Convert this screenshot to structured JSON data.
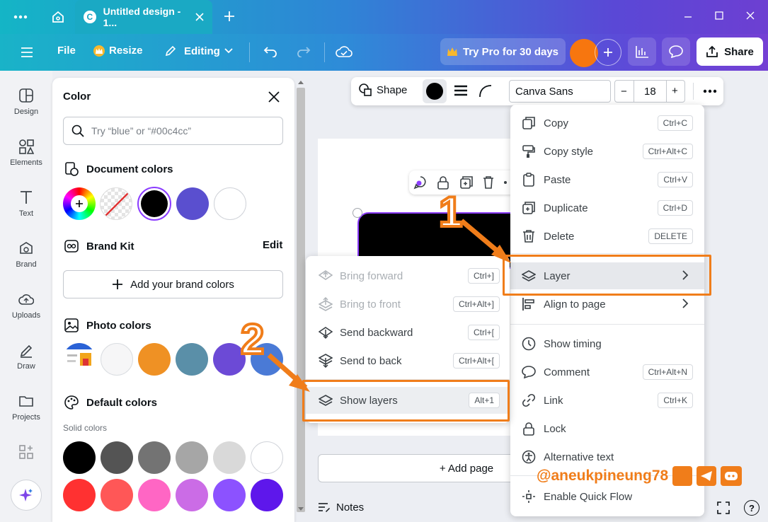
{
  "titlebar": {
    "tab_title": "Untitled design - 1...",
    "tab_logo": "C"
  },
  "toolbar": {
    "file": "File",
    "resize": "Resize",
    "editing": "Editing",
    "try_pro": "Try Pro for 30 days",
    "share": "Share",
    "avatar_color": "#f7760f"
  },
  "rail": [
    {
      "label": "Design",
      "icon": "design-icon"
    },
    {
      "label": "Elements",
      "icon": "elements-icon"
    },
    {
      "label": "Text",
      "icon": "text-icon"
    },
    {
      "label": "Brand",
      "icon": "brand-icon"
    },
    {
      "label": "Uploads",
      "icon": "uploads-icon"
    },
    {
      "label": "Draw",
      "icon": "draw-icon"
    },
    {
      "label": "Projects",
      "icon": "projects-icon"
    }
  ],
  "color_panel": {
    "title": "Color",
    "search_placeholder": "Try “blue” or “#00c4cc”",
    "document_colors_title": "Document colors",
    "document_colors": [
      "#000000",
      "#5a4fcf",
      "#ffffff"
    ],
    "brand_kit_title": "Brand Kit",
    "brand_kit_edit": "Edit",
    "add_brand_colors": "Add your brand colors",
    "photo_colors_title": "Photo colors",
    "photo_colors": [
      "#f6f6f7",
      "#ef9124",
      "#5a8fa8",
      "#6c4ad6",
      "#4a7ad6"
    ],
    "default_colors_title": "Default colors",
    "solid_colors_label": "Solid colors",
    "default_row1": [
      "#000000",
      "#545454",
      "#737373",
      "#a6a6a6",
      "#d9d9d9",
      "#ffffff"
    ],
    "default_row2": [
      "#ff3131",
      "#ff5757",
      "#ff66c4",
      "#cb6ce6",
      "#8c52ff",
      "#5e17eb"
    ]
  },
  "element_toolbar": {
    "shape": "Shape",
    "font": "Canva Sans",
    "font_size": "18",
    "minus": "−",
    "plus": "+"
  },
  "canvas": {
    "add_page": "+ Add page",
    "notes": "Notes"
  },
  "context_menu": [
    {
      "label": "Copy",
      "shortcut": "Ctrl+C",
      "icon": "copy-icon"
    },
    {
      "label": "Copy style",
      "shortcut": "Ctrl+Alt+C",
      "icon": "copy-style-icon"
    },
    {
      "label": "Paste",
      "shortcut": "Ctrl+V",
      "icon": "paste-icon"
    },
    {
      "label": "Duplicate",
      "shortcut": "Ctrl+D",
      "icon": "duplicate-icon"
    },
    {
      "label": "Delete",
      "shortcut": "DELETE",
      "icon": "trash-icon"
    },
    {
      "label": "Layer",
      "icon": "layers-icon"
    },
    {
      "label": "Align to page",
      "icon": "align-icon"
    },
    {
      "label": "Show timing",
      "icon": "clock-icon"
    },
    {
      "label": "Comment",
      "shortcut": "Ctrl+Alt+N",
      "icon": "comment-icon"
    },
    {
      "label": "Link",
      "shortcut": "Ctrl+K",
      "icon": "link-icon"
    },
    {
      "label": "Lock",
      "icon": "lock-icon"
    },
    {
      "label": "Alternative text",
      "icon": "accessibility-icon"
    },
    {
      "label": "Enable Quick Flow",
      "icon": "quick-flow-icon"
    }
  ],
  "layer_submenu": [
    {
      "label": "Bring forward",
      "shortcut": "Ctrl+]",
      "disabled": true
    },
    {
      "label": "Bring to front",
      "shortcut": "Ctrl+Alt+]",
      "disabled": true
    },
    {
      "label": "Send backward",
      "shortcut": "Ctrl+[",
      "disabled": false
    },
    {
      "label": "Send to back",
      "shortcut": "Ctrl+Alt+[",
      "disabled": false
    },
    {
      "label": "Show layers",
      "shortcut": "Alt+1",
      "disabled": false
    }
  ],
  "annotations": {
    "step1": "1",
    "step2": "2",
    "watermark": "@aneukpineung78",
    "accent": "#f07d1a"
  }
}
